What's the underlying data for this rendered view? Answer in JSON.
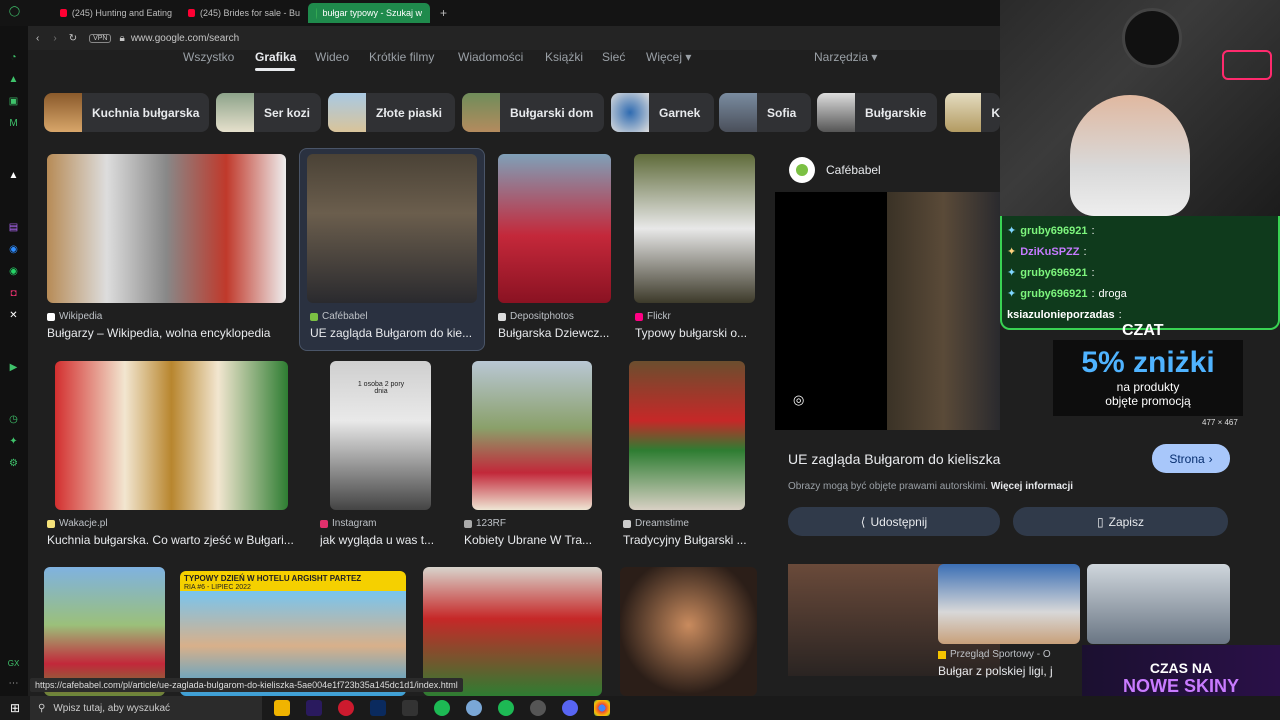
{
  "browser": {
    "tabs": [
      {
        "label": "(245) Hunting and Eating",
        "icon": "youtube-icon"
      },
      {
        "label": "(245) Brides for sale - Bu",
        "icon": "youtube-icon"
      },
      {
        "label": "bułgar typowy - Szukaj w",
        "icon": "google-icon"
      }
    ],
    "new_tab": "+",
    "vpn": "VPN",
    "url": "www.google.com/search"
  },
  "google": {
    "nav_tabs": [
      "Wszystko",
      "Grafika",
      "Wideo",
      "Krótkie filmy",
      "Wiadomości",
      "Książki",
      "Sieć",
      "Więcej"
    ],
    "tools": "Narzędzia",
    "chips": [
      "Kuchnia bułgarska",
      "Ser kozi",
      "Złote piaski",
      "Bułgarski dom",
      "Garnek",
      "Sofia",
      "Bułgarskie",
      "K"
    ],
    "results": [
      {
        "source": "Wikipedia",
        "title": "Bułgarzy – Wikipedia, wolna encyklopedia"
      },
      {
        "source": "Cafébabel",
        "title": "UE zagląda Bułgarom do kie..."
      },
      {
        "source": "Depositphotos",
        "title": "Bułgarska Dziewcz..."
      },
      {
        "source": "Flickr",
        "title": "Typowy bułgarski o..."
      },
      {
        "source": "Wakacje.pl",
        "title": "Kuchnia bułgarska. Co warto zjeść w Bułgari..."
      },
      {
        "source": "Instagram",
        "title": "jak wygląda u was t..."
      },
      {
        "source": "123RF",
        "title": "Kobiety Ubrane W Tra..."
      },
      {
        "source": "Dreamstime",
        "title": "Tradycyjny Bułgarski ..."
      }
    ],
    "thumb_caption": "1 osoba 2 pory dnia",
    "banner_text": "TYPOWY DZIEŃ W HOTELU ARGISHT PARTEZ",
    "banner_sub": "RIA #6 - LIPIEC 2022"
  },
  "panel": {
    "source": "Cafébabel",
    "size": "477 × 467",
    "title": "UE zagląda Bułgarom do kieliszka",
    "visit_button": "Strona",
    "copyright": "Obrazy mogą być objęte prawami autorskimi.",
    "more_info": "Więcej informacji",
    "share": "Udostępnij",
    "save": "Zapisz",
    "related_source": "Przegląd Sportowy - O",
    "related_title": "Bułgar z polskiej ligi, j"
  },
  "overlay": {
    "chat": [
      {
        "user": "gruby696921",
        "text": ""
      },
      {
        "user": "DziKuSPZZ",
        "text": ""
      },
      {
        "user": "gruby696921",
        "text": ""
      },
      {
        "user": "gruby696921",
        "text": "droga"
      },
      {
        "user": "ksiazulonieporzadas",
        "text": ""
      }
    ],
    "chat_label": "CZAT",
    "promo_big": "5% zniżki",
    "promo_line1": "na produkty",
    "promo_line2": "objęte promocją",
    "banner_line1": "CZAS NA",
    "banner_line2": "NOWE SKINY"
  },
  "status_url": "https://cafebabel.com/pl/article/ue-zaglada-bulgarom-do-kieliszka-5ae004e1f723b35a145dc1d1/index.html",
  "taskbar": {
    "search_placeholder": "Wpisz tutaj, aby wyszukać"
  },
  "colors": {
    "accent": "#8ab4f8",
    "chat_border": "#39d353",
    "promo": "#4fb3ff",
    "banner": "#b45cff"
  }
}
